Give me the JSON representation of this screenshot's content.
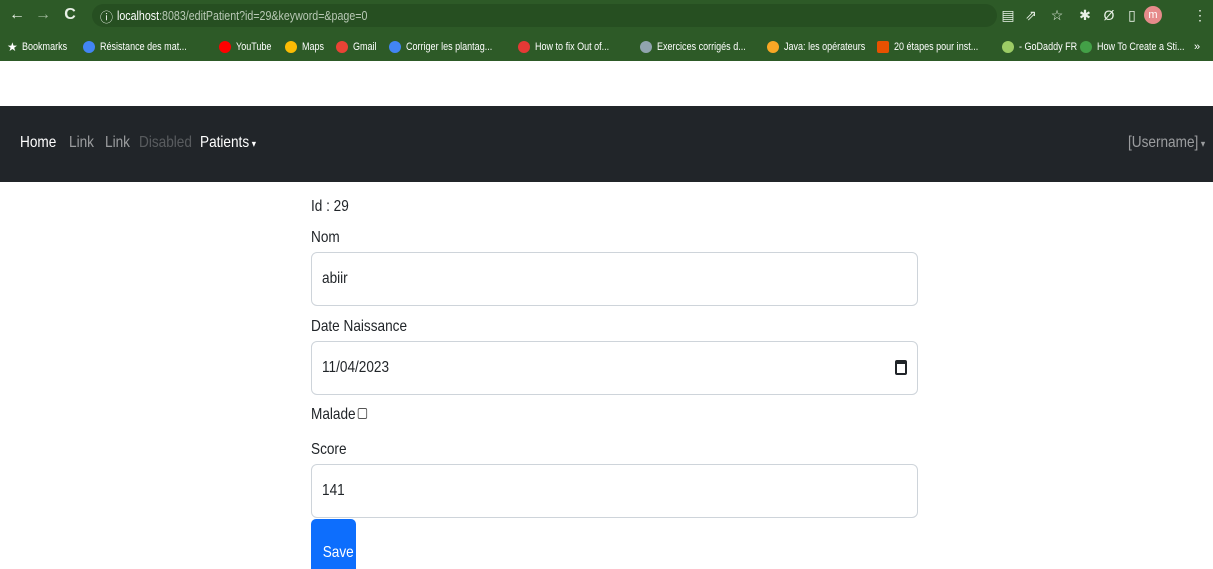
{
  "browser": {
    "url_host": "localhost",
    "url_rest": ":8083/editPatient?id=29&keyword=&page=0",
    "avatar_letter": "m",
    "nav_icons": [
      "back-arrow-icon",
      "forward-arrow-icon",
      "reload-icon",
      "info-icon"
    ],
    "toolbar_icons": [
      "translate-icon",
      "share-icon",
      "star-icon",
      "extensions-icon",
      "extension-icon",
      "sidebar-icon",
      "menu-icon"
    ],
    "bookmarks": [
      {
        "label": "Bookmarks",
        "icon": "star-icon",
        "color": "#ffffff"
      },
      {
        "label": "Résistance des mat...",
        "icon": "google-icon",
        "color": "#4285f4"
      },
      {
        "label": "YouTube",
        "icon": "youtube-icon",
        "color": "#ff0000"
      },
      {
        "label": "Maps",
        "icon": "maps-icon",
        "color": "#fbbc04"
      },
      {
        "label": "Gmail",
        "icon": "gmail-icon",
        "color": "#ea4335"
      },
      {
        "label": "Corriger les plantag...",
        "icon": "google-icon",
        "color": "#4285f4"
      },
      {
        "label": "How to fix Out of...",
        "icon": "site-icon",
        "color": "#e53935"
      },
      {
        "label": "Exercices corrigés d...",
        "icon": "site-icon",
        "color": "#90a4ae"
      },
      {
        "label": "Java: les opérateurs",
        "icon": "site-icon",
        "color": "#f9a825"
      },
      {
        "label": "20 étapes pour inst...",
        "icon": "site-icon",
        "color": "#e65100"
      },
      {
        "label": "- GoDaddy FR",
        "icon": "godaddy-icon",
        "color": "#9ccc65"
      },
      {
        "label": "How To Create a Sti...",
        "icon": "site-icon",
        "color": "#43a047"
      }
    ],
    "more_bookmarks": "»"
  },
  "navbar": {
    "links": [
      "Home",
      "Link",
      "Link",
      "Disabled",
      "Patients"
    ],
    "user": "[Username]",
    "caret": "▾"
  },
  "form": {
    "id_text": "Id : 29",
    "nom_label": "Nom",
    "nom_value": "abiir",
    "date_label": "Date Naissance",
    "date_value": "11/04/2023",
    "malade_label": "Malade",
    "score_label": "Score",
    "score_value": "141",
    "save_label": "Save"
  },
  "colors": {
    "browser_frame": "#2d5a27",
    "navbar_bg": "#212529",
    "primary": "#0d6efd"
  }
}
